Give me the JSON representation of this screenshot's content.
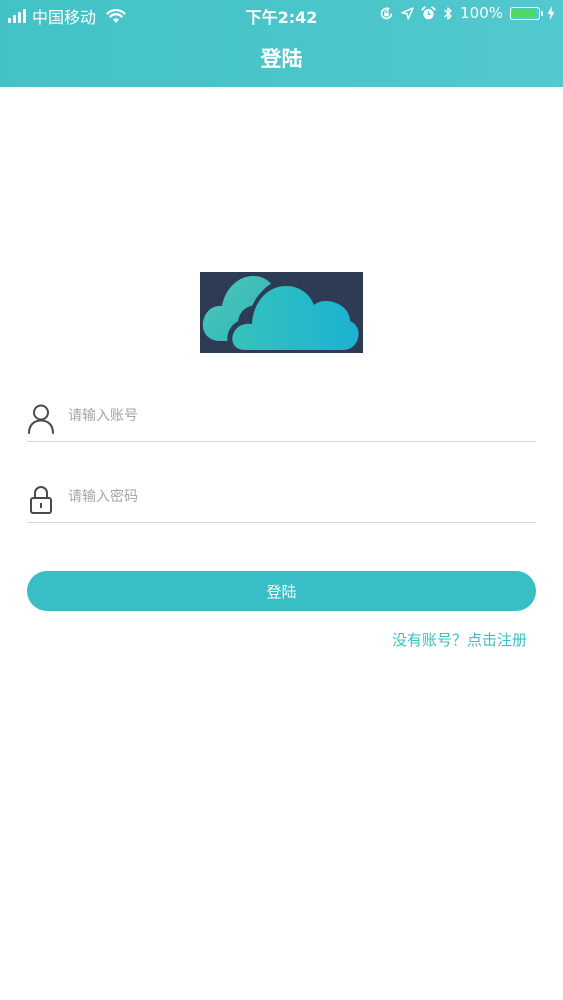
{
  "status_bar": {
    "carrier": "中国移动",
    "time": "下午2:42",
    "battery_percent": "100%",
    "battery_level": 1.0
  },
  "nav": {
    "title": "登陆"
  },
  "form": {
    "account_placeholder": "请输入账号",
    "password_placeholder": "请输入密码",
    "login_label": "登陆",
    "register_link": "没有账号？点击注册"
  },
  "colors": {
    "accent": "#3abfc5",
    "header": "#4bc6ca",
    "logo_bg": "#2e3b55",
    "battery": "#4cd964"
  },
  "icons": {
    "account": "person-icon",
    "password": "lock-icon",
    "logo": "cloud-logo"
  }
}
